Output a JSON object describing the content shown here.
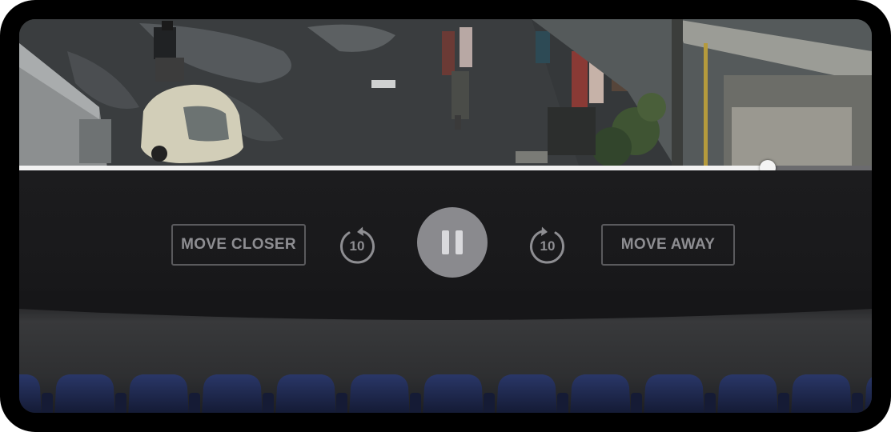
{
  "player": {
    "progress_fraction": 0.878,
    "is_playing": true
  },
  "controls": {
    "move_closer_label": "MOVE CLOSER",
    "move_away_label": "MOVE AWAY",
    "skip_back_seconds": "10",
    "skip_forward_seconds": "10",
    "skip_back_icon": "rewind-10-icon",
    "skip_forward_icon": "forward-10-icon",
    "play_pause_icon": "pause-icon"
  },
  "colors": {
    "bezel": "#000000",
    "panel": "#1c1c1e",
    "button_text": "#8e8e92",
    "progress_played": "#f2f2f2",
    "seat_blue": "#1e2a57"
  }
}
